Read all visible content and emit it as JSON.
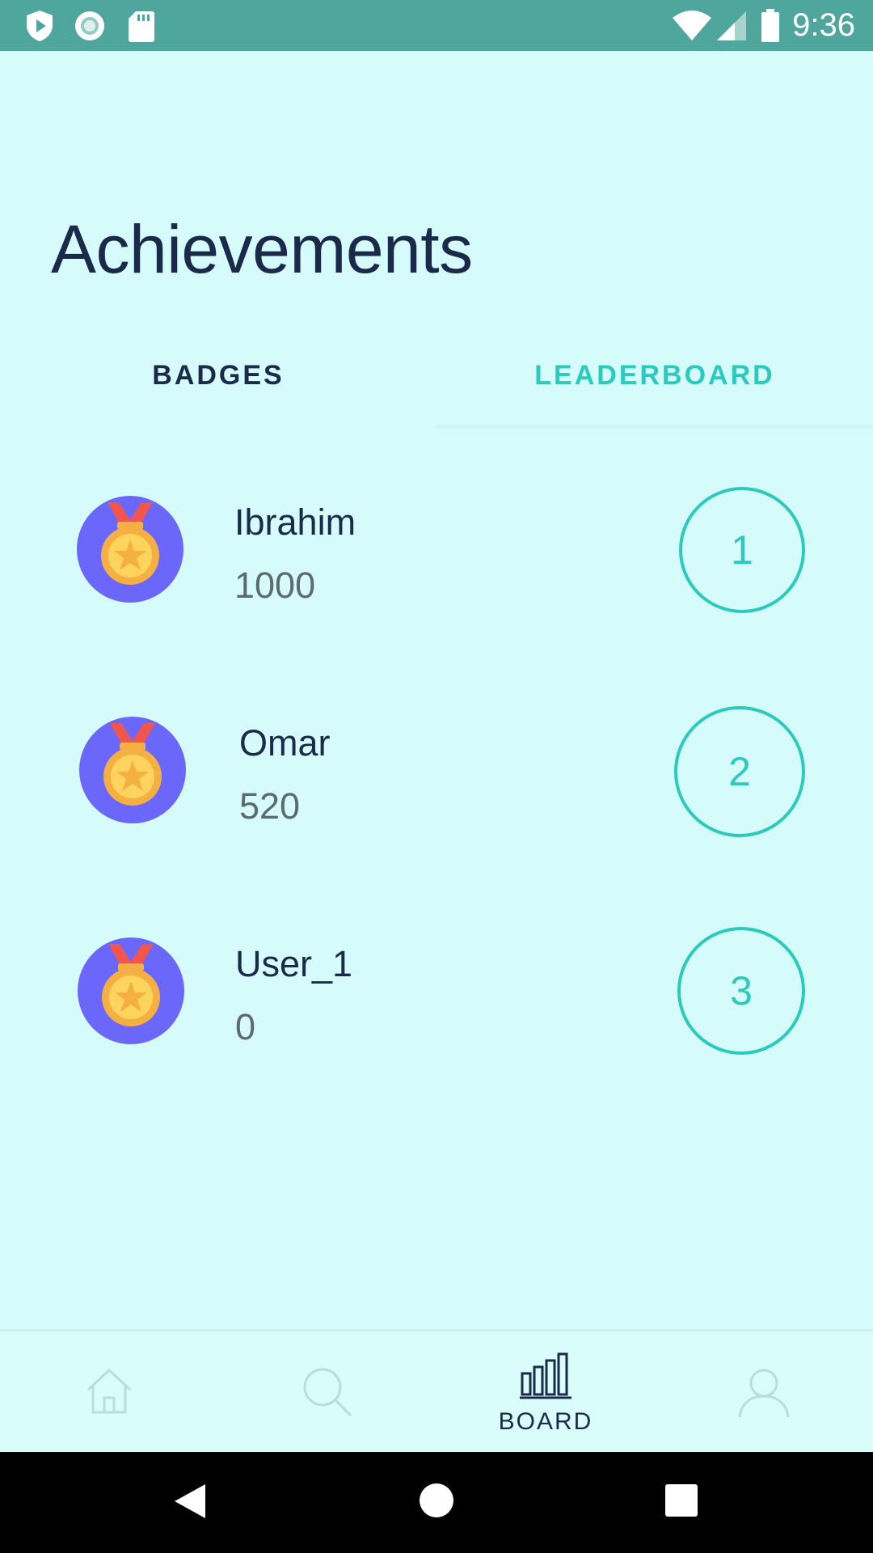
{
  "status_bar": {
    "time": "9:36",
    "left_icons": [
      "shield-play-icon",
      "record-icon",
      "sd-card-icon"
    ],
    "right_icons": [
      "wifi-icon",
      "cell-signal-icon",
      "battery-icon"
    ]
  },
  "page": {
    "title": "Achievements"
  },
  "tabs": [
    {
      "label": "BADGES",
      "active": false
    },
    {
      "label": "LEADERBOARD",
      "active": true
    }
  ],
  "leaderboard": [
    {
      "name": "Ibrahim",
      "score": "1000",
      "rank": "1"
    },
    {
      "name": "Omar",
      "score": "520",
      "rank": "2"
    },
    {
      "name": "User_1",
      "score": "0",
      "rank": "3"
    }
  ],
  "bottom_nav": {
    "items": [
      {
        "icon": "home-icon",
        "label": "",
        "active": false
      },
      {
        "icon": "search-icon",
        "label": "",
        "active": false
      },
      {
        "icon": "bar-chart-icon",
        "label": "BOARD",
        "active": true
      },
      {
        "icon": "person-icon",
        "label": "",
        "active": false
      }
    ]
  },
  "system_nav": {
    "icons": [
      "back-icon",
      "home-circle-icon",
      "recents-icon"
    ]
  },
  "colors": {
    "background": "#d5fcfa",
    "status_bar": "#4fa69c",
    "accent": "#2cc9bd",
    "text_dark": "#1b2a4a",
    "medal_bg": "#6c67fb"
  }
}
